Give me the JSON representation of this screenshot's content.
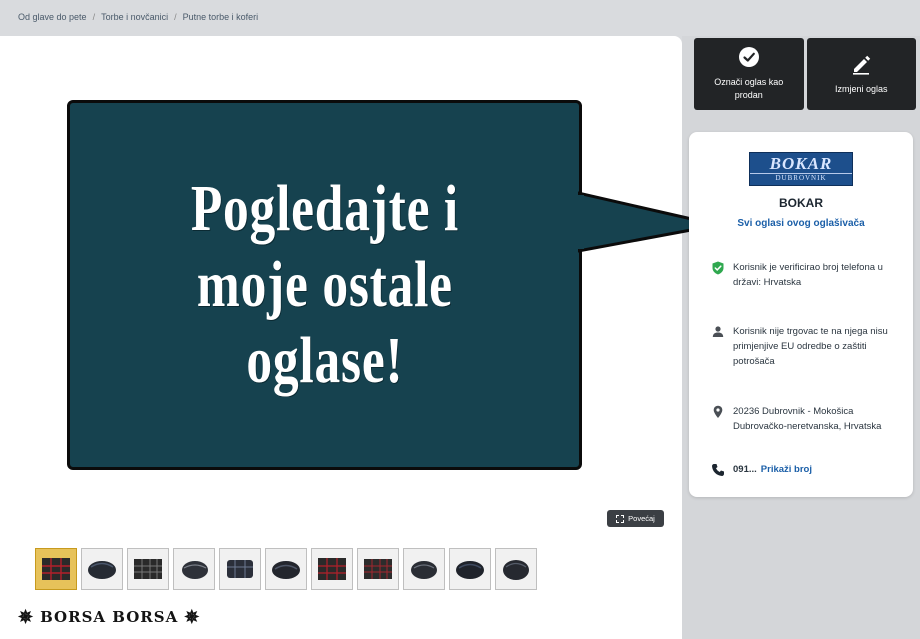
{
  "breadcrumb": [
    "Od glave do pete",
    "Torbe i novčanici",
    "Putne torbe i koferi"
  ],
  "promo": {
    "line1": "Pogledajte i",
    "line2": "moje ostale",
    "line3": "oglase!"
  },
  "actions": {
    "mark_sold": "Označi oglas kao prodan",
    "edit": "Izmjeni oglas"
  },
  "seller": {
    "logo_main": "BOKAR",
    "logo_sub": "DUBROVNIK",
    "name": "BOKAR",
    "all_ads_link": "Svi oglasi ovog oglašivača",
    "verified": "Korisnik je verificirao broj telefona u državi: Hrvatska",
    "trader_note": "Korisnik nije trgovac te na njega nisu primjenjive EU odredbe o zaštiti potrošača",
    "location": "20236 Dubrovnik - Mokošica Dubrovačko-neretvanska, Hrvatska",
    "phone_prefix": "091...",
    "phone_reveal": "Prikaži broj"
  },
  "gallery": {
    "zoom_label": "Povećaj",
    "thumbnail_count": 11
  },
  "footer_tag": "BORSA BORSA",
  "colors": {
    "bubble": "#16424f",
    "link": "#1b5fa8",
    "verified_green": "#2fa84f",
    "action_bg": "#222426"
  }
}
